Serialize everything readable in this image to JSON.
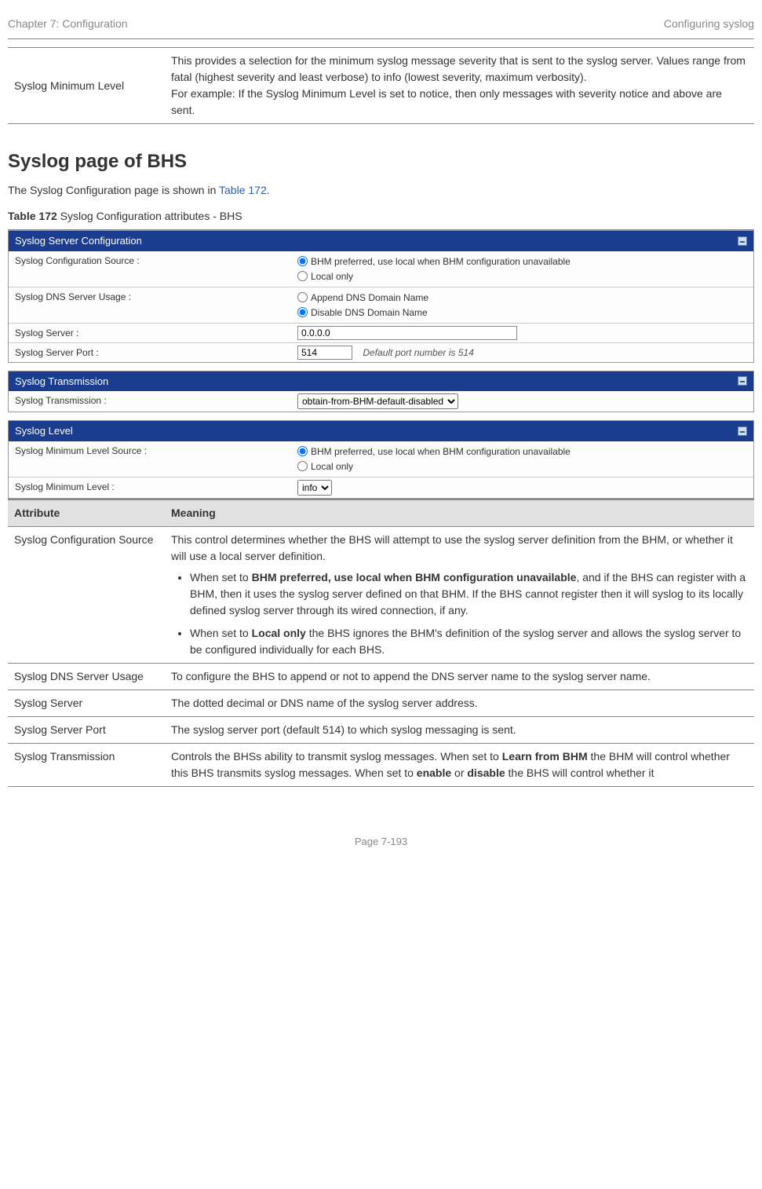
{
  "header": {
    "left": "Chapter 7:  Configuration",
    "right": "Configuring syslog"
  },
  "prev_table": {
    "row_label": "Syslog Minimum Level",
    "row_desc_p1": "This provides a selection for the minimum syslog message severity that is sent to the syslog server. Values range from fatal (highest severity and least verbose) to info (lowest severity, maximum verbosity).",
    "row_desc_p2": "For example: If the Syslog Minimum Level is set to notice, then only messages with severity notice and above are sent."
  },
  "section": {
    "title": "Syslog page of BHS",
    "intro_pre": "The Syslog Configuration page is shown in ",
    "intro_link": "Table 172.",
    "caption_prefix": "Table 172",
    "caption_rest": " Syslog Configuration attributes - BHS"
  },
  "ui": {
    "panel1": {
      "title": "Syslog Server Configuration",
      "rows": {
        "cfgsrc_label": "Syslog Configuration Source :",
        "cfgsrc_opt1": "BHM preferred, use local when BHM configuration unavailable",
        "cfgsrc_opt2": "Local only",
        "dns_label": "Syslog DNS Server Usage :",
        "dns_opt1": "Append DNS Domain Name",
        "dns_opt2": "Disable DNS Domain Name",
        "server_label": "Syslog Server :",
        "server_value": "0.0.0.0",
        "port_label": "Syslog Server Port :",
        "port_value": "514",
        "port_note": "Default port number is 514"
      }
    },
    "panel2": {
      "title": "Syslog Transmission",
      "rows": {
        "trans_label": "Syslog Transmission :",
        "trans_value": "obtain-from-BHM-default-disabled"
      }
    },
    "panel3": {
      "title": "Syslog Level",
      "rows": {
        "minsrc_label": "Syslog Minimum Level Source :",
        "minsrc_opt1": "BHM preferred, use local when BHM configuration unavailable",
        "minsrc_opt2": "Local only",
        "minlvl_label": "Syslog Minimum Level :",
        "minlvl_value": "info"
      }
    }
  },
  "attrtable": {
    "h1": "Attribute",
    "h2": "Meaning",
    "rows": {
      "r1_attr": "Syslog Configuration Source",
      "r1_p1": "This control determines whether the BHS will attempt to use the syslog server definition from the BHM, or whether it will use a local server definition.",
      "r1_li1_pre": "When set to ",
      "r1_li1_bold": "BHM preferred, use local when BHM configuration unavailable",
      "r1_li1_post": ", and if the BHS can register with a BHM, then it uses the syslog server defined on that BHM. If the BHS cannot register then it will syslog to its locally defined syslog server through its wired connection, if any.",
      "r1_li2_pre": "When set to ",
      "r1_li2_bold": "Local only",
      "r1_li2_post": " the BHS ignores the BHM's definition of the syslog server and allows the syslog server to be configured individually for each BHS.",
      "r2_attr": "Syslog DNS Server Usage",
      "r2_desc": "To configure the BHS to append or not to append the DNS server name to the syslog server name.",
      "r3_attr": "Syslog Server",
      "r3_desc": "The dotted decimal or DNS name of the syslog server address.",
      "r4_attr": "Syslog Server Port",
      "r4_desc": "The syslog server port (default 514) to which syslog messaging is sent.",
      "r5_attr": "Syslog Transmission",
      "r5_pre": "Controls the BHSs ability to transmit syslog messages. When set to ",
      "r5_b1": "Learn from BHM",
      "r5_mid": " the BHM will control whether this BHS transmits syslog messages. When set to ",
      "r5_b2": "enable",
      "r5_or": " or ",
      "r5_b3": "disable",
      "r5_post": " the BHS will control whether it"
    }
  },
  "footer": "Page 7-193"
}
